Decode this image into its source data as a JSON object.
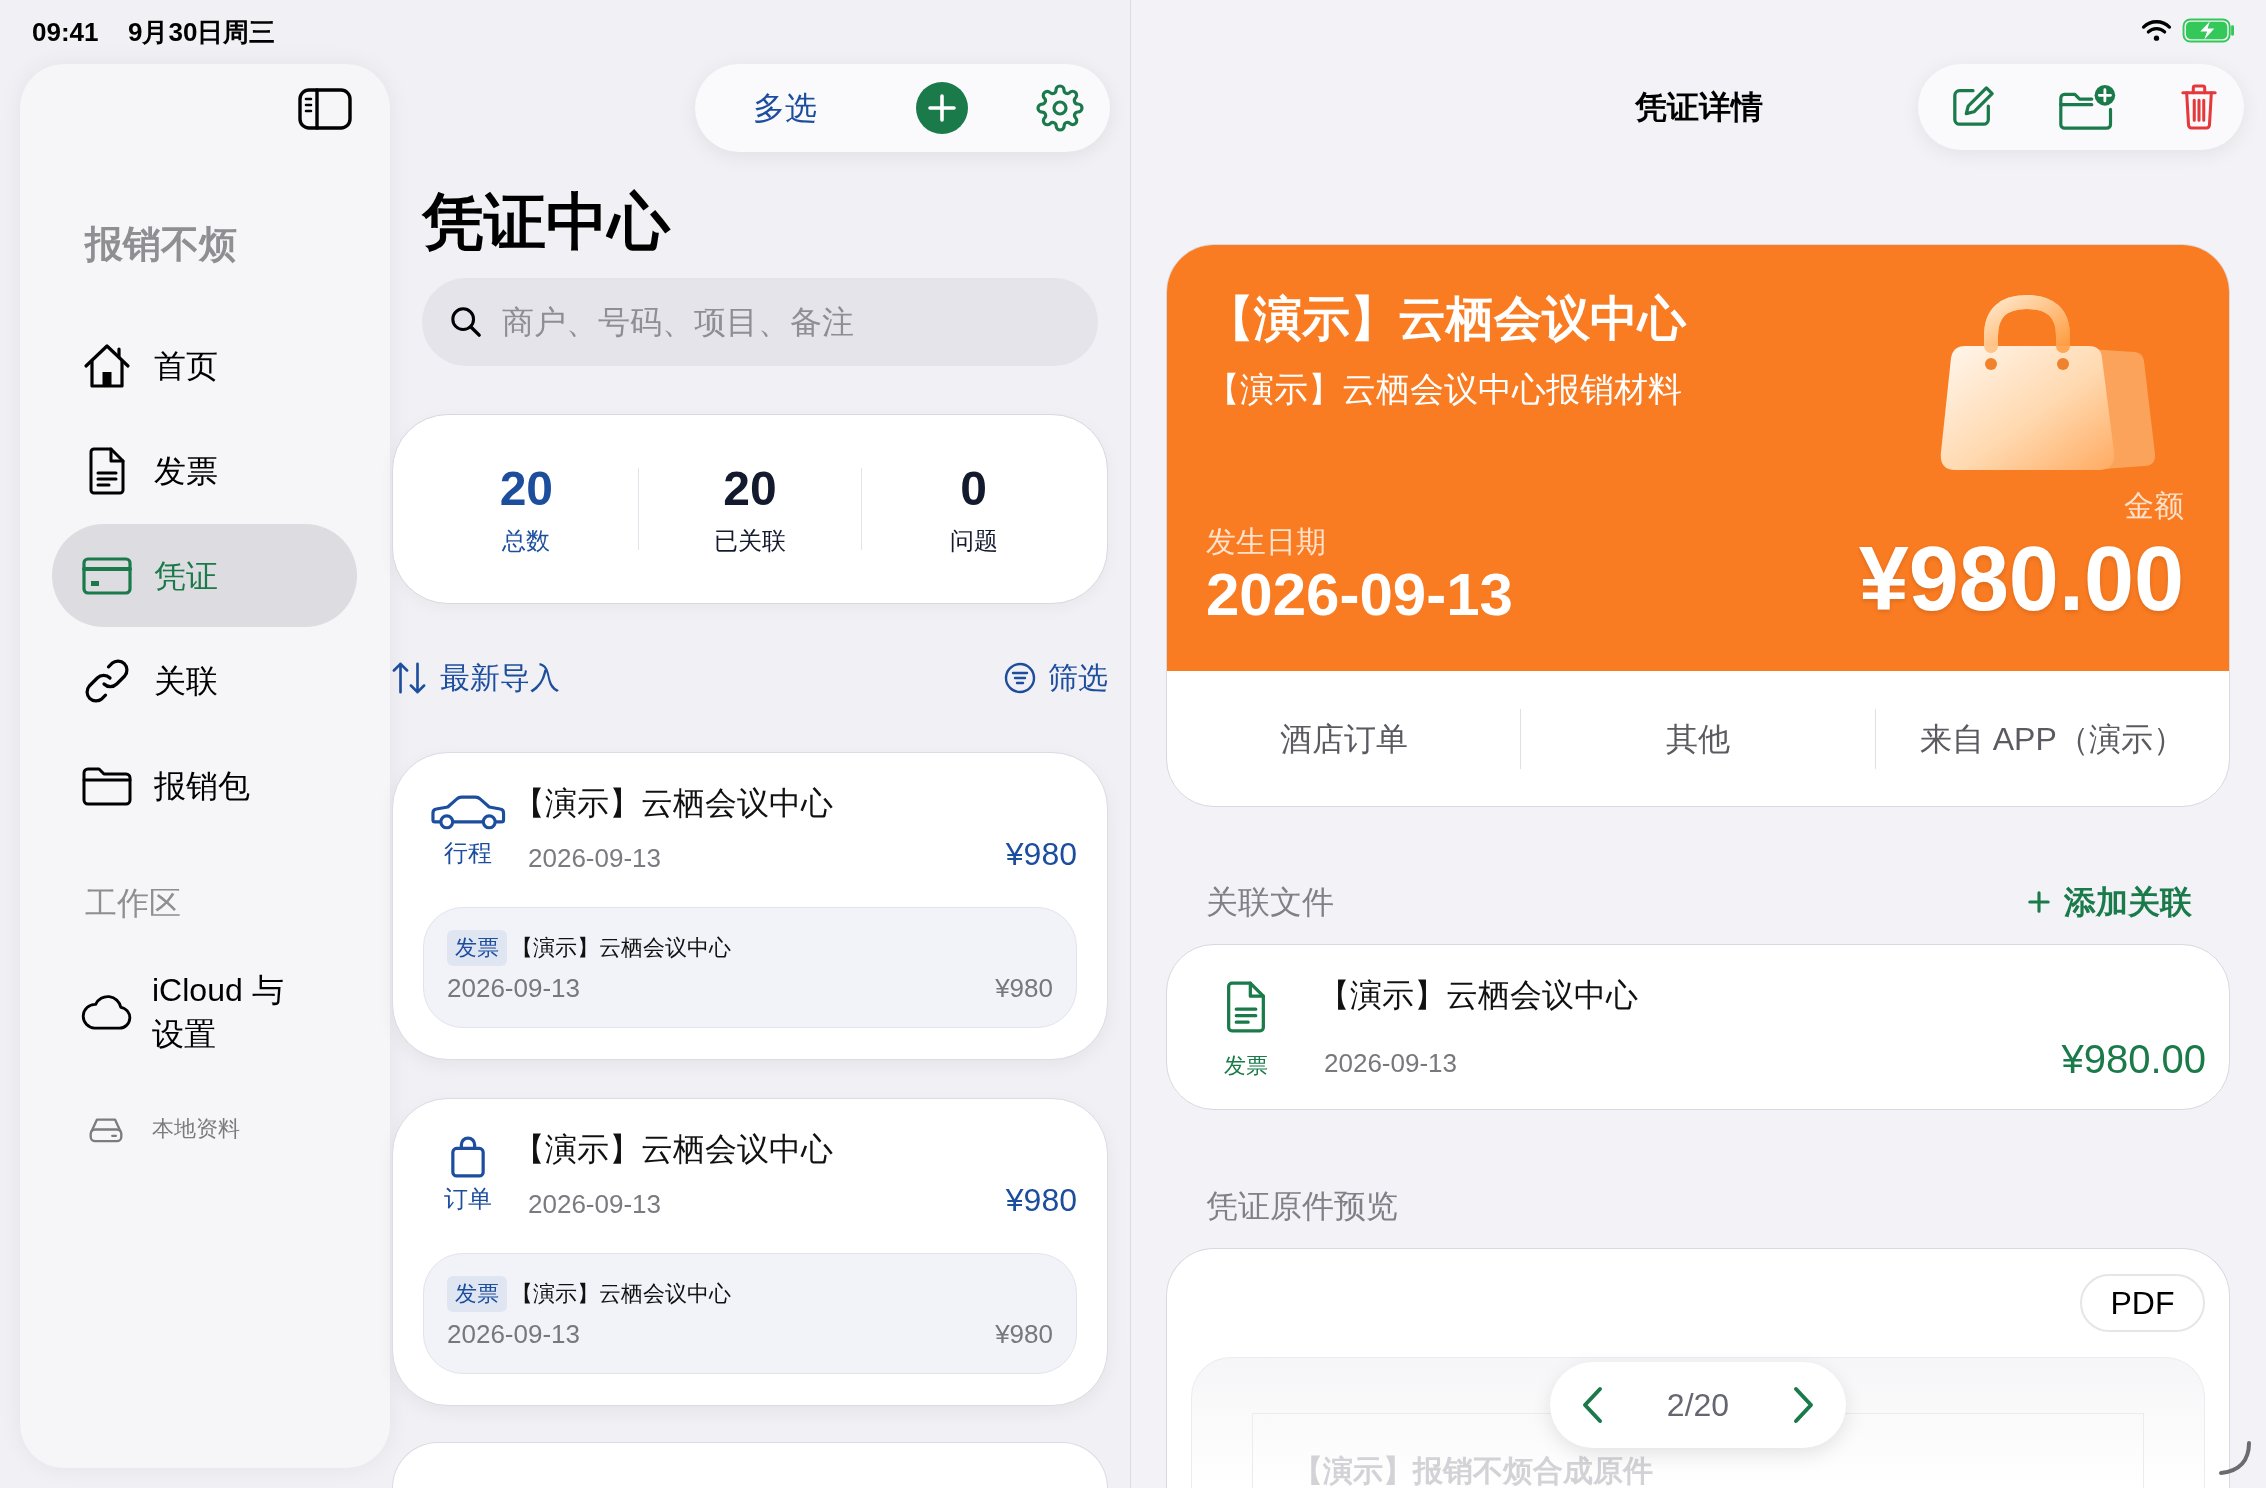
{
  "status_bar": {
    "time": "09:41",
    "date": "9月30日周三",
    "charging": true
  },
  "sidebar": {
    "title": "报销不烦",
    "items": [
      {
        "kind": "home",
        "label": "首页",
        "selected": false
      },
      {
        "kind": "invoice",
        "label": "发票",
        "selected": false
      },
      {
        "kind": "voucher",
        "label": "凭证",
        "selected": true
      },
      {
        "kind": "link",
        "label": "关联",
        "selected": false
      },
      {
        "kind": "package",
        "label": "报销包",
        "selected": false
      }
    ],
    "section_title": "工作区",
    "workspace_items": [
      {
        "kind": "cloud",
        "label": "iCloud 与设置",
        "selected": false
      },
      {
        "kind": "local",
        "label": "本地资料",
        "selected": false
      }
    ]
  },
  "list": {
    "multi_select_label": "多选",
    "title": "凭证中心",
    "search": {
      "placeholder": "商户、号码、项目、备注"
    },
    "stats": [
      {
        "value": "20",
        "label": "总数",
        "selected": true
      },
      {
        "value": "20",
        "label": "已关联",
        "selected": false
      },
      {
        "value": "0",
        "label": "问题",
        "selected": false
      }
    ],
    "sort_label": "最新导入",
    "filter_label": "筛选",
    "vouchers": [
      {
        "kind": "trip",
        "type_label": "行程",
        "title": "【演示】云栖会议中心",
        "date": "2026-09-13",
        "amount": "¥980",
        "linked": {
          "tag": "发票",
          "title": "【演示】云栖会议中心",
          "date": "2026-09-13",
          "amount": "¥980"
        }
      },
      {
        "kind": "order",
        "type_label": "订单",
        "title": "【演示】云栖会议中心",
        "date": "2026-09-13",
        "amount": "¥980",
        "linked": {
          "tag": "发票",
          "title": "【演示】云栖会议中心",
          "date": "2026-09-13",
          "amount": "¥980"
        }
      }
    ]
  },
  "detail": {
    "title": "凭证详情",
    "summary": {
      "title": "【演示】云栖会议中心",
      "subtitle": "【演示】云栖会议中心报销材料",
      "date_label": "发生日期",
      "date": "2026-09-13",
      "amount_label": "金额",
      "amount": "¥980.00",
      "tags": [
        "酒店订单",
        "其他",
        "来自 APP（演示）"
      ]
    },
    "related": {
      "heading": "关联文件",
      "add_label": "添加关联",
      "items": [
        {
          "kind": "invoice",
          "type_label": "发票",
          "title": "【演示】云栖会议中心",
          "date": "2026-09-13",
          "amount": "¥980.00"
        }
      ]
    },
    "preview": {
      "heading": "凭证原件预览",
      "format": "PDF",
      "page": "2/20",
      "document_title": "【演示】报销不烦合成原件"
    }
  }
}
